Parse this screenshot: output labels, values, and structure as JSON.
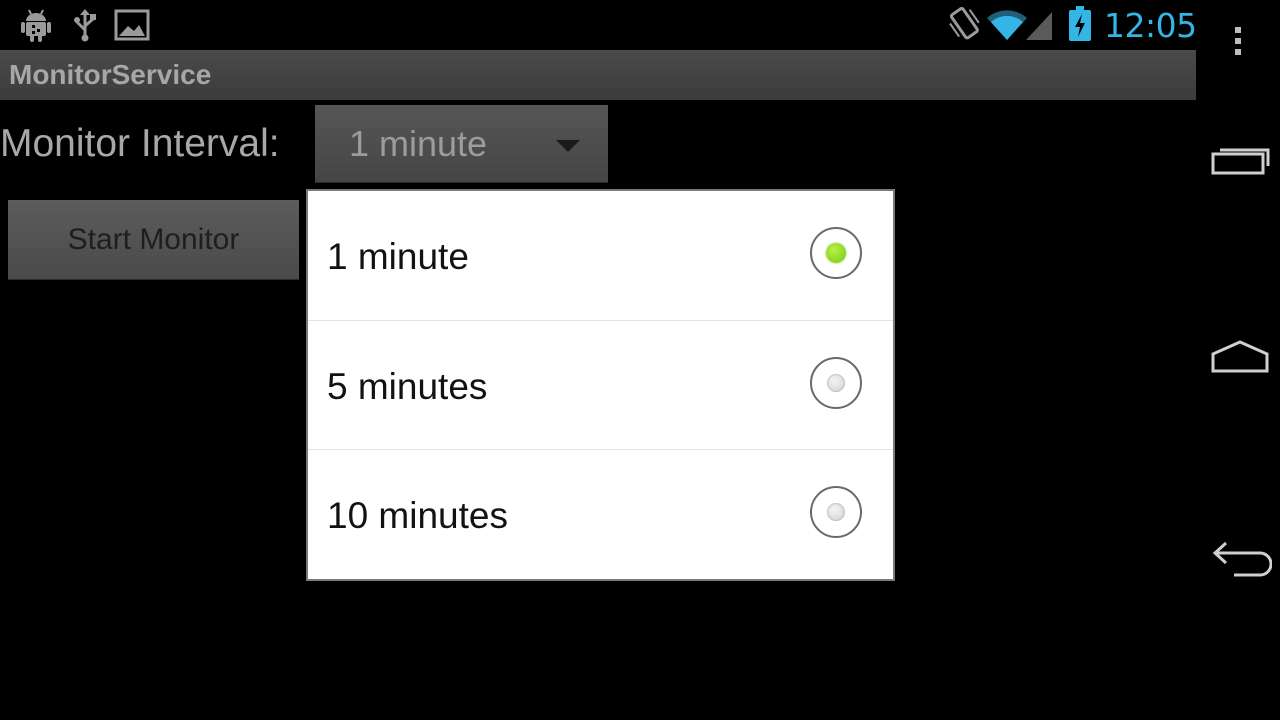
{
  "status_bar": {
    "time": "12:05",
    "icons": [
      "android-debug-icon",
      "usb-icon",
      "image-icon",
      "vibrate-icon",
      "wifi-icon",
      "signal-icon",
      "battery-charging-icon"
    ],
    "accent_color": "#33b5e5"
  },
  "app": {
    "title": "MonitorService"
  },
  "form": {
    "interval_label": "Monitor Interval:",
    "interval_value": "1 minute",
    "start_button_label": "Start Monitor"
  },
  "dropdown": {
    "options": [
      {
        "label": "1 minute",
        "selected": true
      },
      {
        "label": "5 minutes",
        "selected": false
      },
      {
        "label": "10 minutes",
        "selected": false
      }
    ],
    "selected_color": "#8cd22a"
  },
  "nav_bar": {
    "buttons": [
      "overflow-menu-icon",
      "recent-apps-icon",
      "home-icon",
      "back-icon"
    ]
  }
}
